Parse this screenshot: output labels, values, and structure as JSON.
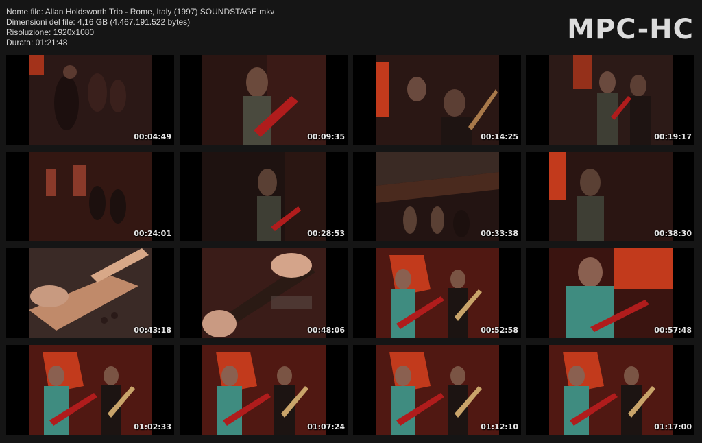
{
  "header": {
    "file_name": "Nome file: Allan Holdsworth Trio - Rome, Italy (1997) SOUNDSTAGE.mkv",
    "file_size": "Dimensioni del file: 4,16 GB (4.467.191.522 bytes)",
    "resolution": "Risoluzione: 1920x1080",
    "duration": "Durata: 01:21:48",
    "logo": "MPC-HC"
  },
  "thumbnails": [
    {
      "time": "00:04:49",
      "scene": "dark-stage-group"
    },
    {
      "time": "00:09:35",
      "scene": "guitarist-closeup-dark"
    },
    {
      "time": "00:14:25",
      "scene": "bassist-red-sign"
    },
    {
      "time": "00:19:17",
      "scene": "trio-wide-dark"
    },
    {
      "time": "00:24:01",
      "scene": "stage-wide-dark"
    },
    {
      "time": "00:28:53",
      "scene": "guitarist-dark-profile"
    },
    {
      "time": "00:33:38",
      "scene": "ceiling-wide-shot"
    },
    {
      "time": "00:38:30",
      "scene": "guitarist-red-sign"
    },
    {
      "time": "00:43:18",
      "scene": "bass-neck-closeup"
    },
    {
      "time": "00:48:06",
      "scene": "guitar-frets-closeup"
    },
    {
      "time": "00:52:58",
      "scene": "duo-lit-stage"
    },
    {
      "time": "00:57:48",
      "scene": "guitarist-lit-closeup"
    },
    {
      "time": "01:02:33",
      "scene": "duo-lit-stage"
    },
    {
      "time": "01:07:24",
      "scene": "duo-lit-stage"
    },
    {
      "time": "01:12:10",
      "scene": "duo-lit-stage"
    },
    {
      "time": "01:17:00",
      "scene": "duo-lit-stage"
    }
  ],
  "colors": {
    "background": "#151515",
    "text": "#d6d6d6",
    "stage_dark": "#2a1412",
    "curtain_red": "#5a1a14",
    "sign_red": "#c23a1c",
    "shirt_teal": "#3f8c80",
    "guitar_red": "#b01c1c"
  }
}
